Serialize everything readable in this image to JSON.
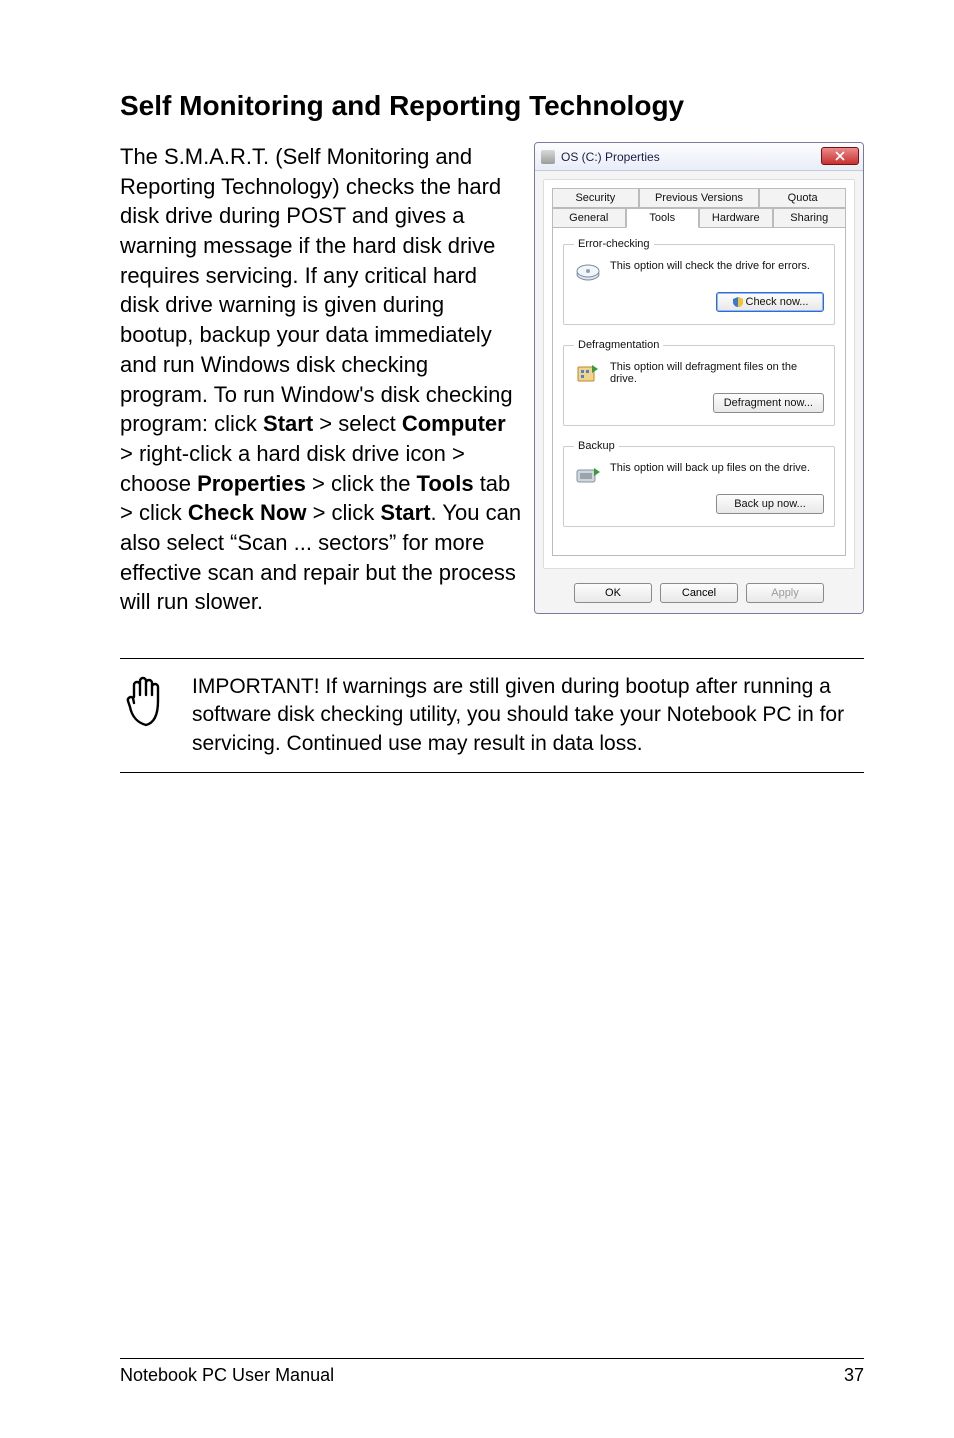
{
  "heading": "Self Monitoring and Reporting Technology",
  "paragraph_parts": {
    "p1": "The S.M.A.R.T. (Self Monitoring and Reporting Technology) checks the hard disk drive during POST and gives a warning message if the hard disk drive requires servicing. If any critical hard disk drive warning is given during bootup, backup your data immediately and run Windows disk checking program. To run Window's disk checking program: click ",
    "b1": "Start",
    "p2": " > select ",
    "b2": "Computer",
    "p3": " > right-click a hard disk drive icon > choose ",
    "b3": "Properties",
    "p4": " > click the ",
    "b4": "Tools",
    "p5": " tab > click ",
    "b5": "Check Now",
    "p6": " > click ",
    "b6": "Start",
    "p7": ". You can also select “Scan ... sectors” for more effective scan and repair but the process will run slower."
  },
  "dialog": {
    "title": "OS (C:) Properties",
    "tabs_row1": [
      "Security",
      "Previous Versions",
      "Quota"
    ],
    "tabs_row2": [
      "General",
      "Tools",
      "Hardware",
      "Sharing"
    ],
    "error_checking": {
      "legend": "Error-checking",
      "text": "This option will check the drive for errors.",
      "button": "Check now..."
    },
    "defragmentation": {
      "legend": "Defragmentation",
      "text": "This option will defragment files on the drive.",
      "button": "Defragment now..."
    },
    "backup": {
      "legend": "Backup",
      "text": "This option will back up files on the drive.",
      "button": "Back up now..."
    },
    "bottom": {
      "ok": "OK",
      "cancel": "Cancel",
      "apply": "Apply"
    }
  },
  "important": "IMPORTANT! If warnings are still given during bootup after running a software disk checking utility, you should take your Notebook PC in for servicing. Continued use may result in data loss.",
  "footer": {
    "left": "Notebook PC User Manual",
    "right": "37"
  }
}
